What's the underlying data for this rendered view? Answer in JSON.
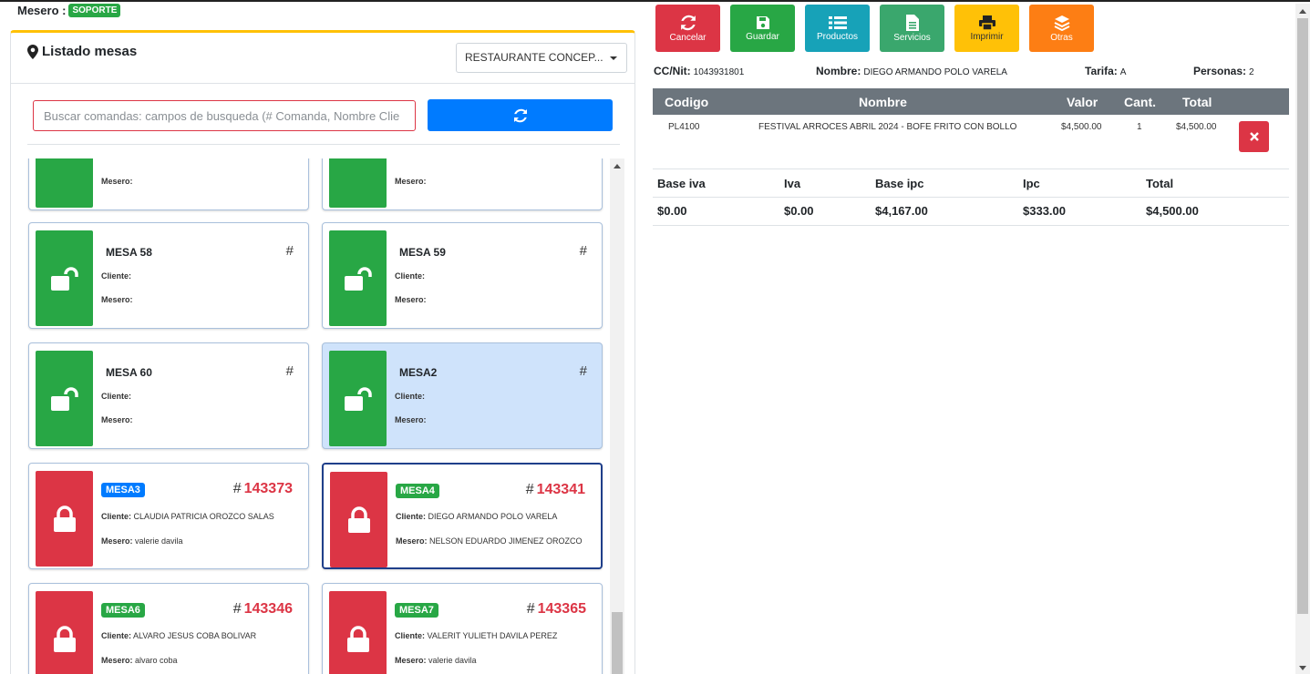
{
  "header": {
    "mesero_label": "Mesero :",
    "role_badge": "SOPORTE"
  },
  "left": {
    "title": "Listado mesas",
    "restaurant_select": "RESTAURANTE CONCEP...",
    "search_placeholder": "Buscar comandas: campos de busqueda (# Comanda, Nombre Clie",
    "cliente_label": "Cliente:",
    "mesero_label": "Mesero:",
    "hash": "#",
    "partial_top": [
      {
        "mesero": ""
      },
      {
        "mesero": ""
      }
    ],
    "free_tables": [
      {
        "name": "MESA 58",
        "cliente": "",
        "mesero": ""
      },
      {
        "name": "MESA 59",
        "cliente": "",
        "mesero": ""
      },
      {
        "name": "MESA 60",
        "cliente": "",
        "mesero": ""
      },
      {
        "name": "MESA2",
        "cliente": "",
        "mesero": ""
      }
    ],
    "busy_tables": [
      {
        "name": "MESA3",
        "badge_color": "#007bff",
        "number": "143373",
        "cliente": "CLAUDIA PATRICIA OROZCO SALAS",
        "mesero": "valerie davila"
      },
      {
        "name": "MESA4",
        "badge_color": "#28a745",
        "number": "143341",
        "cliente": "DIEGO ARMANDO POLO VARELA",
        "mesero": "NELSON EDUARDO JIMENEZ OROZCO"
      },
      {
        "name": "MESA6",
        "badge_color": "#28a745",
        "number": "143346",
        "cliente": "ALVARO JESUS COBA BOLIVAR",
        "mesero": "alvaro coba"
      },
      {
        "name": "MESA7",
        "badge_color": "#28a745",
        "number": "143365",
        "cliente": "VALERIT YULIETH DAVILA PEREZ",
        "mesero": "valerie davila"
      }
    ]
  },
  "actions": [
    {
      "label": "Cancelar",
      "icon": "refresh-icon"
    },
    {
      "label": "Guardar",
      "icon": "save-icon"
    },
    {
      "label": "Productos",
      "icon": "list-icon"
    },
    {
      "label": "Servicios",
      "icon": "file-icon"
    },
    {
      "label": "Imprimir",
      "icon": "print-icon"
    },
    {
      "label": "Otras",
      "icon": "layers-icon"
    }
  ],
  "info": {
    "ccnit_label": "CC/Nit:",
    "ccnit": "1043931801",
    "nombre_label": "Nombre:",
    "nombre": "DIEGO ARMANDO POLO VARELA",
    "tarifa_label": "Tarifa:",
    "tarifa": "A",
    "personas_label": "Personas:",
    "personas": "2"
  },
  "items_table": {
    "headers": [
      "Codigo",
      "Nombre",
      "Valor",
      "Cant.",
      "Total"
    ],
    "rows": [
      {
        "codigo": "PL4100",
        "nombre": "FESTIVAL ARROCES ABRIL 2024 - BOFE FRITO CON BOLLO",
        "valor": "$4,500.00",
        "cant": "1",
        "total": "$4,500.00"
      }
    ]
  },
  "totals": {
    "headers": [
      "Base iva",
      "Iva",
      "Base ipc",
      "Ipc",
      "Total"
    ],
    "values": [
      "$0.00",
      "$0.00",
      "$4,167.00",
      "$333.00",
      "$4,500.00"
    ]
  }
}
